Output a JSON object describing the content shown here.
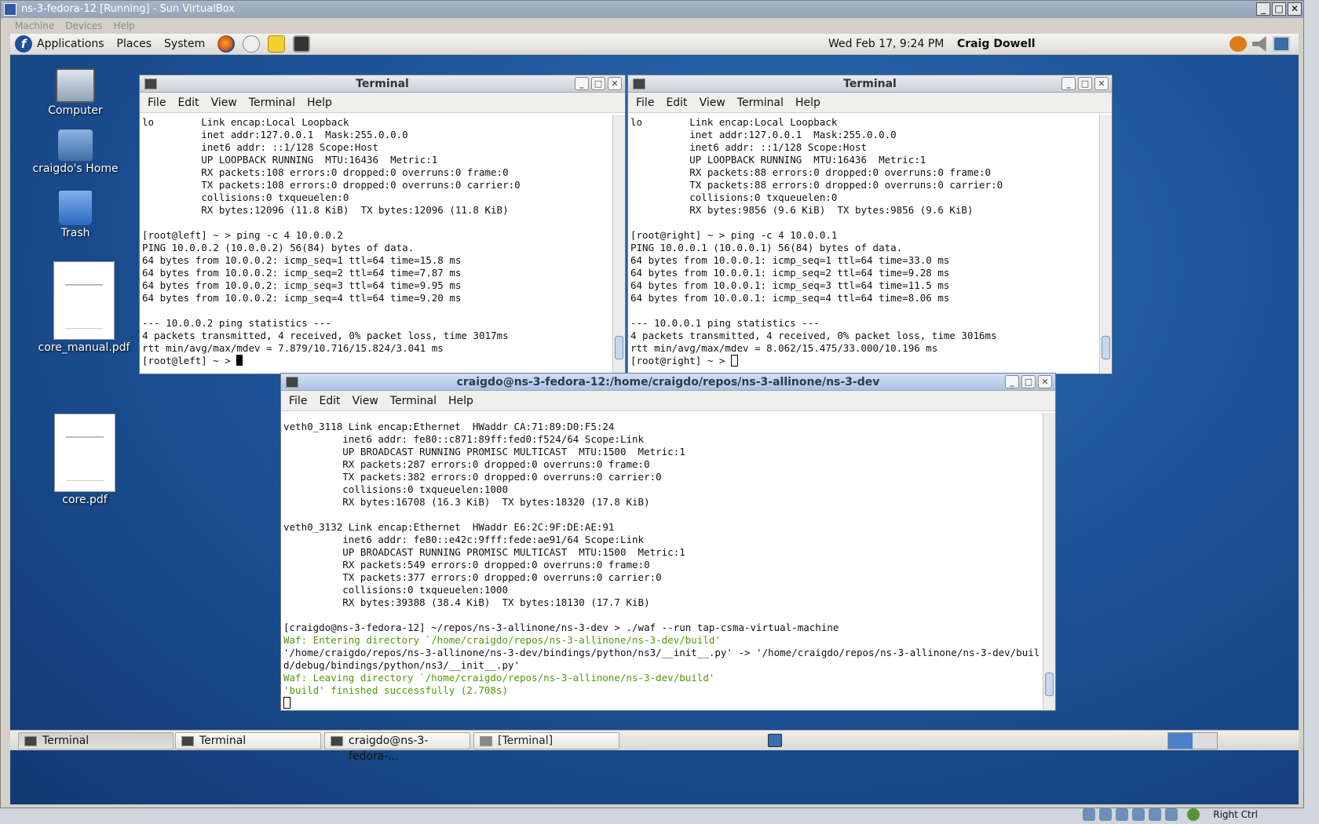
{
  "vbox": {
    "title": "ns-3-fedora-12 [Running] - Sun VirtualBox",
    "menu": [
      "Machine",
      "Devices",
      "Help"
    ],
    "host_key_label": "Right Ctrl"
  },
  "top_panel": {
    "menus": [
      "Applications",
      "Places",
      "System"
    ],
    "clock": "Wed Feb 17,  9:24 PM",
    "user": "Craig Dowell"
  },
  "desktop_icons": [
    {
      "label": "Computer",
      "icon": "computer-icon"
    },
    {
      "label": "craigdo's Home",
      "icon": "home-folder-icon"
    },
    {
      "label": "Trash",
      "icon": "trash-icon"
    },
    {
      "label": "core_manual.pdf",
      "icon": "pdf-document-icon"
    },
    {
      "label": "core.pdf",
      "icon": "pdf-document-icon"
    }
  ],
  "terminal_menu": [
    "File",
    "Edit",
    "View",
    "Terminal",
    "Help"
  ],
  "terminals": {
    "left": {
      "title": "Terminal",
      "lines": [
        "lo        Link encap:Local Loopback",
        "          inet addr:127.0.0.1  Mask:255.0.0.0",
        "          inet6 addr: ::1/128 Scope:Host",
        "          UP LOOPBACK RUNNING  MTU:16436  Metric:1",
        "          RX packets:108 errors:0 dropped:0 overruns:0 frame:0",
        "          TX packets:108 errors:0 dropped:0 overruns:0 carrier:0",
        "          collisions:0 txqueuelen:0",
        "          RX bytes:12096 (11.8 KiB)  TX bytes:12096 (11.8 KiB)",
        "",
        "[root@left] ~ > ping -c 4 10.0.0.2",
        "PING 10.0.0.2 (10.0.0.2) 56(84) bytes of data.",
        "64 bytes from 10.0.0.2: icmp_seq=1 ttl=64 time=15.8 ms",
        "64 bytes from 10.0.0.2: icmp_seq=2 ttl=64 time=7.87 ms",
        "64 bytes from 10.0.0.2: icmp_seq=3 ttl=64 time=9.95 ms",
        "64 bytes from 10.0.0.2: icmp_seq=4 ttl=64 time=9.20 ms",
        "",
        "--- 10.0.0.2 ping statistics ---",
        "4 packets transmitted, 4 received, 0% packet loss, time 3017ms",
        "rtt min/avg/max/mdev = 7.879/10.716/15.824/3.041 ms"
      ],
      "prompt": "[root@left] ~ > "
    },
    "right": {
      "title": "Terminal",
      "lines": [
        "lo        Link encap:Local Loopback",
        "          inet addr:127.0.0.1  Mask:255.0.0.0",
        "          inet6 addr: ::1/128 Scope:Host",
        "          UP LOOPBACK RUNNING  MTU:16436  Metric:1",
        "          RX packets:88 errors:0 dropped:0 overruns:0 frame:0",
        "          TX packets:88 errors:0 dropped:0 overruns:0 carrier:0",
        "          collisions:0 txqueuelen:0",
        "          RX bytes:9856 (9.6 KiB)  TX bytes:9856 (9.6 KiB)",
        "",
        "[root@right] ~ > ping -c 4 10.0.0.1",
        "PING 10.0.0.1 (10.0.0.1) 56(84) bytes of data.",
        "64 bytes from 10.0.0.1: icmp_seq=1 ttl=64 time=33.0 ms",
        "64 bytes from 10.0.0.1: icmp_seq=2 ttl=64 time=9.28 ms",
        "64 bytes from 10.0.0.1: icmp_seq=3 ttl=64 time=11.5 ms",
        "64 bytes from 10.0.0.1: icmp_seq=4 ttl=64 time=8.06 ms",
        "",
        "--- 10.0.0.1 ping statistics ---",
        "4 packets transmitted, 4 received, 0% packet loss, time 3016ms",
        "rtt min/avg/max/mdev = 8.062/15.475/33.000/10.196 ms"
      ],
      "prompt": "[root@right] ~ > "
    },
    "bottom": {
      "title": "craigdo@ns-3-fedora-12:/home/craigdo/repos/ns-3-allinone/ns-3-dev",
      "lines": [
        {
          "text": "veth0_3118 Link encap:Ethernet  HWaddr CA:71:89:D0:F5:24",
          "green": false
        },
        {
          "text": "          inet6 addr: fe80::c871:89ff:fed0:f524/64 Scope:Link",
          "green": false
        },
        {
          "text": "          UP BROADCAST RUNNING PROMISC MULTICAST  MTU:1500  Metric:1",
          "green": false
        },
        {
          "text": "          RX packets:287 errors:0 dropped:0 overruns:0 frame:0",
          "green": false
        },
        {
          "text": "          TX packets:382 errors:0 dropped:0 overruns:0 carrier:0",
          "green": false
        },
        {
          "text": "          collisions:0 txqueuelen:1000",
          "green": false
        },
        {
          "text": "          RX bytes:16708 (16.3 KiB)  TX bytes:18320 (17.8 KiB)",
          "green": false
        },
        {
          "text": "",
          "green": false
        },
        {
          "text": "veth0_3132 Link encap:Ethernet  HWaddr E6:2C:9F:DE:AE:91",
          "green": false
        },
        {
          "text": "          inet6 addr: fe80::e42c:9fff:fede:ae91/64 Scope:Link",
          "green": false
        },
        {
          "text": "          UP BROADCAST RUNNING PROMISC MULTICAST  MTU:1500  Metric:1",
          "green": false
        },
        {
          "text": "          RX packets:549 errors:0 dropped:0 overruns:0 frame:0",
          "green": false
        },
        {
          "text": "          TX packets:377 errors:0 dropped:0 overruns:0 carrier:0",
          "green": false
        },
        {
          "text": "          collisions:0 txqueuelen:1000",
          "green": false
        },
        {
          "text": "          RX bytes:39388 (38.4 KiB)  TX bytes:18130 (17.7 KiB)",
          "green": false
        },
        {
          "text": "",
          "green": false
        },
        {
          "text": "[craigdo@ns-3-fedora-12] ~/repos/ns-3-allinone/ns-3-dev > ./waf --run tap-csma-virtual-machine",
          "green": false
        },
        {
          "text": "Waf: Entering directory `/home/craigdo/repos/ns-3-allinone/ns-3-dev/build'",
          "green": true
        },
        {
          "text": "'/home/craigdo/repos/ns-3-allinone/ns-3-dev/bindings/python/ns3/__init__.py' -> '/home/craigdo/repos/ns-3-allinone/ns-3-dev/buil",
          "green": false
        },
        {
          "text": "d/debug/bindings/python/ns3/__init__.py'",
          "green": false
        },
        {
          "text": "Waf: Leaving directory `/home/craigdo/repos/ns-3-allinone/ns-3-dev/build'",
          "green": true
        },
        {
          "text": "'build' finished successfully (2.708s)",
          "green": true
        }
      ]
    }
  },
  "taskbar": [
    {
      "label": "Terminal",
      "pressed": true
    },
    {
      "label": "Terminal",
      "pressed": false
    },
    {
      "label": "craigdo@ns-3-fedora-...",
      "pressed": false
    },
    {
      "label": "[Terminal]",
      "pressed": false
    }
  ],
  "colors": {
    "terminal_green": "#4e9a06",
    "desktop_blue": "#1d5499",
    "active_title": "#a9c3e3"
  }
}
